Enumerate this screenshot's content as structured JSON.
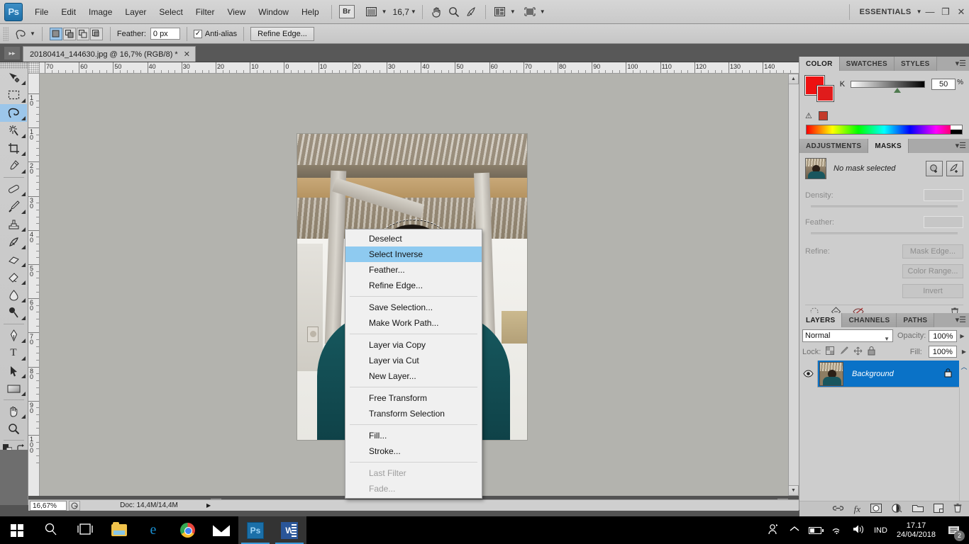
{
  "app": {
    "logo": "Ps",
    "workspace": "ESSENTIALS",
    "minimize": "—",
    "restore": "❐",
    "close": "✕"
  },
  "menubar": {
    "items": [
      "File",
      "Edit",
      "Image",
      "Layer",
      "Select",
      "Filter",
      "View",
      "Window",
      "Help"
    ],
    "bridge_label": "Br",
    "view_extras_icon": "screen-mode-icon",
    "zoom_value": "16,7",
    "hand_icon": "hand-icon",
    "zoom_icon": "magnifier-icon",
    "rotate_view_icon": "rotate-view-icon",
    "arrange_icon": "arrange-documents-icon",
    "screen_mode_icon": "screen-mode-icon"
  },
  "optionsbar": {
    "tool_icon": "lasso-tool-icon",
    "selection_modes": [
      "new-selection",
      "add-to-selection",
      "subtract-from-selection",
      "intersect-with-selection"
    ],
    "active_selection_mode": 0,
    "feather_label": "Feather:",
    "feather_value": "0 px",
    "antialias_label": "Anti-alias",
    "antialias_checked": true,
    "refine_edge_label": "Refine Edge..."
  },
  "document": {
    "tab_title": "20180414_144630.jpg @ 16,7% (RGB/8) *",
    "close_icon": "✕"
  },
  "toolbar": {
    "tools": [
      {
        "name": "move-tool",
        "glyph": "✥",
        "has_submenu": true
      },
      {
        "name": "rectangular-marquee-tool",
        "glyph": "▭",
        "has_submenu": true
      },
      {
        "name": "lasso-tool",
        "glyph": "✒",
        "has_submenu": true,
        "active": true
      },
      {
        "name": "quick-selection-tool",
        "glyph": "✶",
        "has_submenu": true
      },
      {
        "name": "crop-tool",
        "glyph": "⊹",
        "has_submenu": true
      },
      {
        "name": "eyedropper-tool",
        "glyph": "⚲",
        "has_submenu": true
      },
      {
        "name": "spot-healing-brush-tool",
        "glyph": "▰",
        "has_submenu": true
      },
      {
        "name": "brush-tool",
        "glyph": "✎",
        "has_submenu": true
      },
      {
        "name": "clone-stamp-tool",
        "glyph": "⎙",
        "has_submenu": true
      },
      {
        "name": "history-brush-tool",
        "glyph": "✧",
        "has_submenu": true
      },
      {
        "name": "eraser-tool",
        "glyph": "▱",
        "has_submenu": true
      },
      {
        "name": "gradient-tool",
        "glyph": "◨",
        "has_submenu": true
      },
      {
        "name": "blur-tool",
        "glyph": "◌",
        "has_submenu": true
      },
      {
        "name": "dodge-tool",
        "glyph": "●",
        "has_submenu": true
      },
      {
        "name": "pen-tool",
        "glyph": "✑",
        "has_submenu": true
      },
      {
        "name": "horizontal-type-tool",
        "glyph": "T",
        "has_submenu": true
      },
      {
        "name": "path-selection-tool",
        "glyph": "➤",
        "has_submenu": true
      },
      {
        "name": "rectangle-tool",
        "glyph": "▬",
        "has_submenu": true
      },
      {
        "name": "hand-tool",
        "glyph": "✋",
        "has_submenu": true
      },
      {
        "name": "zoom-tool",
        "glyph": "⚲",
        "has_submenu": false
      }
    ],
    "default_colors_icon": "default-colors-icon",
    "swap_colors_icon": "swap-colors-icon",
    "foreground_color": "#ee1111",
    "background_color": "#e01c1c",
    "quickmask_icon": "quick-mask-icon"
  },
  "rulers": {
    "unit": "cm",
    "h_labels": [
      "70",
      "60",
      "50",
      "40",
      "30",
      "20",
      "10",
      "0",
      "10",
      "20",
      "30",
      "40",
      "50",
      "60",
      "70",
      "80",
      "90",
      "100",
      "110",
      "120",
      "130",
      "140"
    ],
    "v_labels": [
      "10",
      "10",
      "20",
      "30",
      "40",
      "50",
      "60",
      "70",
      "80",
      "90",
      "100"
    ]
  },
  "contextmenu": {
    "groups": [
      [
        {
          "label": "Deselect",
          "disabled": false,
          "selected": false
        },
        {
          "label": "Select Inverse",
          "disabled": false,
          "selected": true
        },
        {
          "label": "Feather...",
          "disabled": false,
          "selected": false
        },
        {
          "label": "Refine Edge...",
          "disabled": false,
          "selected": false
        }
      ],
      [
        {
          "label": "Save Selection...",
          "disabled": false,
          "selected": false
        },
        {
          "label": "Make Work Path...",
          "disabled": false,
          "selected": false
        }
      ],
      [
        {
          "label": "Layer via Copy",
          "disabled": false,
          "selected": false
        },
        {
          "label": "Layer via Cut",
          "disabled": false,
          "selected": false
        },
        {
          "label": "New Layer...",
          "disabled": false,
          "selected": false
        }
      ],
      [
        {
          "label": "Free Transform",
          "disabled": false,
          "selected": false
        },
        {
          "label": "Transform Selection",
          "disabled": false,
          "selected": false
        }
      ],
      [
        {
          "label": "Fill...",
          "disabled": false,
          "selected": false
        },
        {
          "label": "Stroke...",
          "disabled": false,
          "selected": false
        }
      ],
      [
        {
          "label": "Last Filter",
          "disabled": true,
          "selected": false
        },
        {
          "label": "Fade...",
          "disabled": true,
          "selected": false
        }
      ]
    ],
    "highlight_color": "#8ecaf0"
  },
  "statusbar": {
    "zoom": "16,67%",
    "thumbnail_icon": "document-thumbnail-icon",
    "doc_info": "Doc: 14,4M/14,4M",
    "expand_icon": "▶"
  },
  "panels": {
    "color_group": {
      "tabs": [
        "COLOR",
        "SWATCHES",
        "STYLES"
      ],
      "active_tab": "COLOR",
      "menu_icon": "panel-menu-icon",
      "channel_label": "K",
      "channel_value": "50",
      "percent_symbol": "%",
      "foreground_color": "#ee1111",
      "background_color": "#e01c1c",
      "out_of_gamut_icon": "gamut-warning-icon",
      "out_of_gamut_color": "#c33a2a"
    },
    "masks_group": {
      "tabs": [
        "ADJUSTMENTS",
        "MASKS"
      ],
      "active_tab": "MASKS",
      "menu_icon": "panel-menu-icon",
      "status_text": "No mask selected",
      "pixel_mask_icon": "add-pixel-mask-icon",
      "vector_mask_icon": "add-vector-mask-icon",
      "density_label": "Density:",
      "density_value": "",
      "feather_label": "Feather:",
      "feather_value": "",
      "refine_label": "Refine:",
      "mask_edge_label": "Mask Edge...",
      "color_range_label": "Color Range...",
      "invert_label": "Invert",
      "footer_icons": [
        "load-selection-icon",
        "apply-mask-icon",
        "disable-mask-icon",
        "delete-mask-icon"
      ]
    },
    "layers_group": {
      "tabs": [
        "LAYERS",
        "CHANNELS",
        "PATHS"
      ],
      "active_tab": "LAYERS",
      "menu_icon": "panel-menu-icon",
      "blend_mode": "Normal",
      "opacity_label": "Opacity:",
      "opacity_value": "100%",
      "lock_label": "Lock:",
      "lock_icons": [
        "lock-transparent-pixels-icon",
        "lock-image-pixels-icon",
        "lock-position-icon",
        "lock-all-icon"
      ],
      "fill_label": "Fill:",
      "fill_value": "100%",
      "layers": [
        {
          "name": "Background",
          "visible": true,
          "locked": true,
          "selected": true
        }
      ],
      "footer_icons": [
        "link-layers-icon",
        "layer-style-icon",
        "layer-mask-icon",
        "adjustment-layer-icon",
        "new-group-icon",
        "new-layer-icon",
        "delete-layer-icon"
      ],
      "footer_fx_label": "fx"
    }
  },
  "taskbar": {
    "items": [
      {
        "name": "start-button",
        "icon": "windows-logo-icon"
      },
      {
        "name": "search-button",
        "icon": "search-icon"
      },
      {
        "name": "task-view-button",
        "icon": "task-view-icon"
      },
      {
        "name": "file-explorer-button",
        "icon": "folder-icon"
      },
      {
        "name": "edge-button",
        "icon": "edge-icon"
      },
      {
        "name": "chrome-button",
        "icon": "chrome-icon"
      },
      {
        "name": "mail-button",
        "icon": "mail-icon"
      },
      {
        "name": "photoshop-button",
        "icon": "photoshop-icon",
        "active": true
      },
      {
        "name": "word-button",
        "icon": "word-icon",
        "active": true
      }
    ],
    "tray": {
      "people_icon": "people-icon",
      "chevron_icon": "show-hidden-icons-icon",
      "battery_icon": "battery-icon",
      "wifi_icon": "wifi-icon",
      "volume_icon": "volume-icon",
      "language": "IND",
      "time": "17.17",
      "date": "24/04/2018",
      "notification_icon": "action-center-icon",
      "notification_count": "2"
    }
  }
}
